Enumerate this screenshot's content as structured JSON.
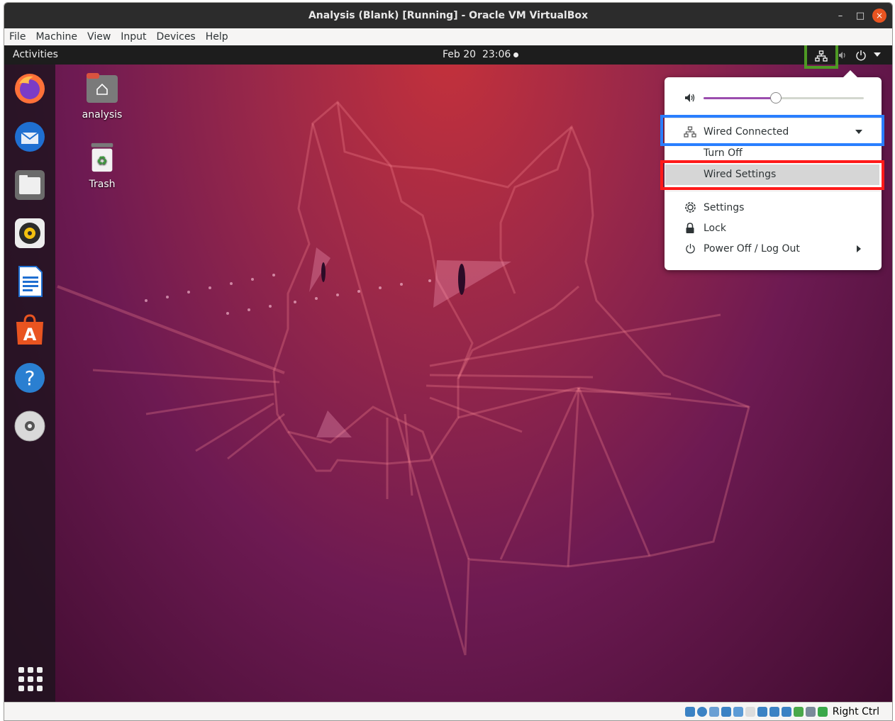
{
  "window": {
    "title": "Analysis (Blank) [Running] - Oracle VM VirtualBox",
    "controls": {
      "minimize": "–",
      "maximize": "□",
      "close": "×"
    }
  },
  "menubar": {
    "items": [
      "File",
      "Machine",
      "View",
      "Input",
      "Devices",
      "Help"
    ]
  },
  "topbar": {
    "activities": "Activities",
    "date": "Feb 20",
    "time": "23:06"
  },
  "desktop": {
    "icons": [
      {
        "label": "analysis",
        "icon": "home-folder-icon"
      },
      {
        "label": "Trash",
        "icon": "trash-icon"
      }
    ]
  },
  "dock": {
    "apps": [
      "firefox-icon",
      "thunderbird-icon",
      "files-icon",
      "rhythmbox-icon",
      "libreoffice-writer-icon",
      "ubuntu-software-icon",
      "help-icon",
      "dvd-icon"
    ]
  },
  "popup": {
    "volume_level": 0.45,
    "network_label": "Wired Connected",
    "turn_off": "Turn Off",
    "wired_settings": "Wired Settings",
    "settings": "Settings",
    "lock": "Lock",
    "power": "Power Off / Log Out"
  },
  "statusbar": {
    "host_key": "Right Ctrl"
  },
  "colors": {
    "highlight_green": "#4e9a24",
    "highlight_blue": "#2a7fff",
    "highlight_red": "#ff1a1a",
    "accent_orange": "#e95420",
    "volume_fill": "#9b4dae"
  }
}
